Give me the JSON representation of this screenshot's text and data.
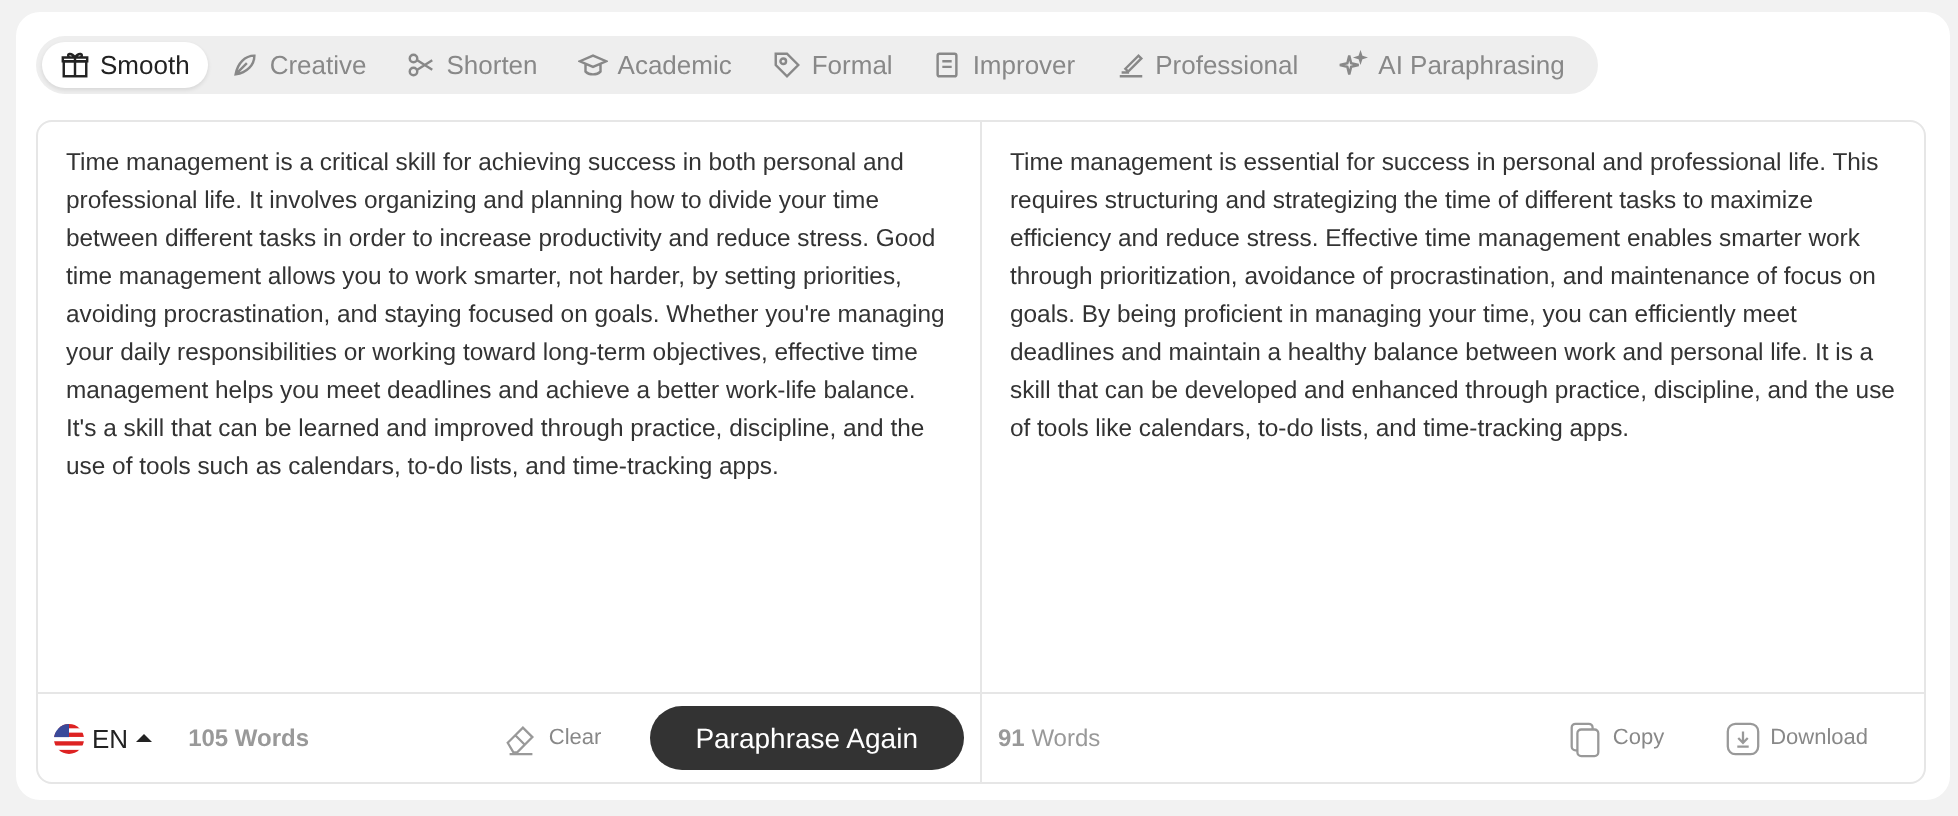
{
  "modes": [
    {
      "label": "Smooth",
      "selected": true
    },
    {
      "label": "Creative",
      "selected": false
    },
    {
      "label": "Shorten",
      "selected": false
    },
    {
      "label": "Academic",
      "selected": false
    },
    {
      "label": "Formal",
      "selected": false
    },
    {
      "label": "Improver",
      "selected": false
    },
    {
      "label": "Professional",
      "selected": false
    },
    {
      "label": "AI Paraphrasing",
      "selected": false
    }
  ],
  "input": {
    "text": "Time management is a critical skill for achieving success in both personal and professional life. It involves organizing and planning how to divide your time between different tasks in order to increase productivity and reduce stress. Good time management allows you to work smarter, not harder, by setting priorities, avoiding procrastination, and staying focused on goals. Whether you're managing your daily responsibilities or working toward long-term objectives, effective time management helps you meet deadlines and achieve a better work-life balance. It's a skill that can be learned and improved through practice, discipline, and the use of tools such as calendars, to-do lists, and time-tracking apps.",
    "language": "EN",
    "word_count": "105 Words",
    "clear": "Clear",
    "paraphrase_button": "Paraphrase Again"
  },
  "output": {
    "text": "Time management is essential for success in personal and professional life. This requires structuring and strategizing the time of different tasks to maximize efficiency and reduce stress. Effective time management enables smarter work through prioritization, avoidance of procrastination, and maintenance of focus on goals. By being proficient in managing your time, you can efficiently meet deadlines and maintain a healthy balance between work and personal life. It is a skill that can be developed and enhanced through practice, discipline, and the use of tools like calendars, to-do lists, and time-tracking apps.",
    "word_count": "**91** Words",
    "copy": "Copy",
    "download": "Download"
  }
}
